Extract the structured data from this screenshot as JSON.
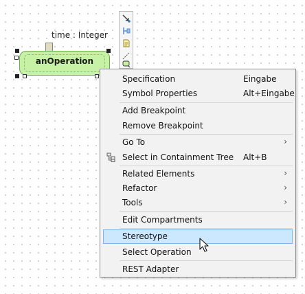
{
  "diagram": {
    "pin_label": "time : Integer",
    "action_name": "anOperation"
  },
  "toolbar": {
    "icons": [
      "control-flow-icon",
      "object-flow-icon",
      "note-icon",
      "link-icon",
      "action-icon"
    ]
  },
  "context_menu": {
    "items": [
      {
        "label": "Specification",
        "shortcut": "Eingabe"
      },
      {
        "label": "Symbol Properties",
        "shortcut": "Alt+Eingabe"
      },
      {
        "label": "Add Breakpoint"
      },
      {
        "label": "Remove Breakpoint"
      },
      {
        "label": "Go To",
        "arrow": "›"
      },
      {
        "label": "Select in Containment Tree",
        "shortcut": "Alt+B",
        "icon": "containment-tree-icon"
      },
      {
        "label": "Related Elements",
        "arrow": "›"
      },
      {
        "label": "Refactor",
        "arrow": "›"
      },
      {
        "label": "Tools",
        "arrow": "›"
      },
      {
        "label": "Edit Compartments"
      },
      {
        "label": "Stereotype",
        "highlighted": true
      },
      {
        "label": "Select Operation"
      },
      {
        "label": "REST Adapter"
      }
    ]
  },
  "colors": {
    "action_fill": "#c7f2a6",
    "highlight": "#cce8ff"
  }
}
